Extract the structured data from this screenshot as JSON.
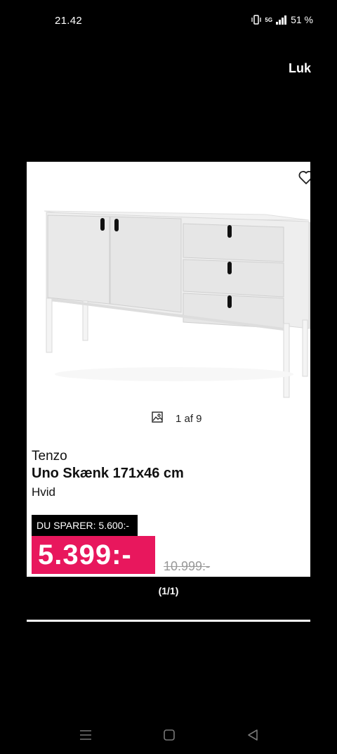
{
  "status_bar": {
    "time": "21.42",
    "network": "5G",
    "battery": "51 %"
  },
  "header": {
    "close_label": "Luk"
  },
  "product": {
    "image_counter": "1 af 9",
    "brand": "Tenzo",
    "title": "Uno Skænk 171x46 cm",
    "variant": "Hvid",
    "savings_label": "DU SPARER: 5.600:-",
    "price": "5.399:-",
    "old_price": "10.999:-"
  },
  "pager": "(1/1)",
  "colors": {
    "price_badge": "#e8175d",
    "background": "#000000"
  },
  "icons": {
    "favorite": "heart-icon",
    "gallery": "image-icon",
    "nav_menu": "menu-icon",
    "nav_home": "home-icon",
    "nav_back": "back-icon"
  }
}
